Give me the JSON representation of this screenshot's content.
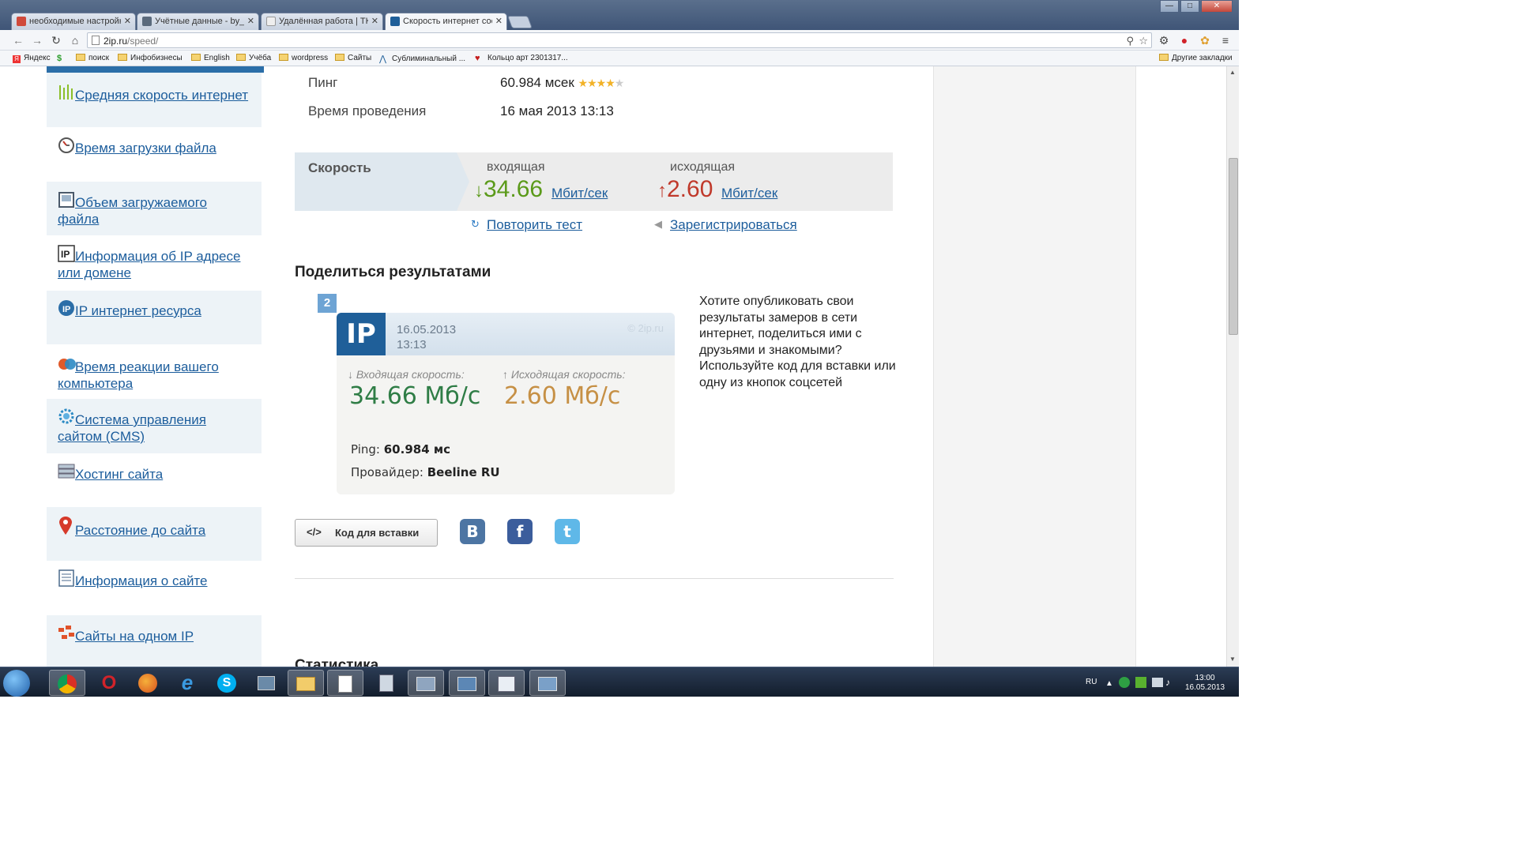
{
  "browser": {
    "tabs": [
      {
        "title": "необходимые настройки",
        "icon_color": "#d04a3b"
      },
      {
        "title": "Учётные данные - by_ma",
        "icon_color": "#5a6a7c"
      },
      {
        "title": "Удалённая работа | ТКС",
        "icon_color": "#dddddd"
      },
      {
        "title": "Скорость интернет соед",
        "icon_color": "#1f5f99"
      }
    ],
    "window_buttons": {
      "minimize": "—",
      "maximize": "□",
      "close": "✕"
    },
    "url_host": "2ip.ru",
    "url_path": "/speed/",
    "bookmarks": [
      {
        "label": "Яндекс",
        "type": "yandex"
      },
      {
        "label": "",
        "type": "money"
      },
      {
        "label": "поиск",
        "type": "folder"
      },
      {
        "label": "Инфобизнесы",
        "type": "folder"
      },
      {
        "label": "English",
        "type": "folder"
      },
      {
        "label": "Учёба",
        "type": "folder"
      },
      {
        "label": "wordpress",
        "type": "folder"
      },
      {
        "label": "Сайты",
        "type": "folder"
      },
      {
        "label": "Сублиминальный ...",
        "type": "triangle"
      },
      {
        "label": "Кольцо арт 2301317...",
        "type": "heart"
      }
    ],
    "other_bookmarks": "Другие закладки"
  },
  "sidebar": {
    "items": [
      {
        "label": "Средняя скорость интернет",
        "icon": "speed-bars-icon"
      },
      {
        "label": "Время загрузки файла",
        "icon": "clock-icon"
      },
      {
        "label": "Объем загружаемого файла",
        "icon": "disk-icon"
      },
      {
        "label": "Информация об IP адресе или домене",
        "icon": "ip-info-icon"
      },
      {
        "label": "IP интернет ресурса",
        "icon": "ip-globe-icon"
      },
      {
        "label": "Время реакции вашего компьютера",
        "icon": "refresh-icon"
      },
      {
        "label": "Система управления сайтом (CMS)",
        "icon": "gear-globe-icon"
      },
      {
        "label": "Хостинг сайта",
        "icon": "server-icon"
      },
      {
        "label": "Расстояние до сайта",
        "icon": "map-pin-icon"
      },
      {
        "label": "Информация о сайте",
        "icon": "document-icon"
      },
      {
        "label": "Сайты на одном IP",
        "icon": "network-icon"
      }
    ]
  },
  "result": {
    "ping_label": "Пинг",
    "ping_value": "60.984 мсек",
    "ping_rating": 4,
    "ping_rating_max": 5,
    "time_label": "Время проведения",
    "time_value": "16 мая 2013 13:13",
    "speed_label": "Скорость",
    "incoming_label": "входящая",
    "incoming_value": "34.66",
    "outgoing_label": "исходящая",
    "outgoing_value": "2.60",
    "unit": "Мбит/сек",
    "arrow_down": "↓",
    "arrow_up": "↑",
    "retest_label": "Повторить тест",
    "register_label": "Зарегистрироваться"
  },
  "share": {
    "title": "Поделиться результатами",
    "card": {
      "number": "2",
      "logo": "IP",
      "date": "16.05.2013",
      "time": "13:13",
      "brand": "© 2ip.ru",
      "in_label": "↓ Входящая скорость:",
      "in_value": "34.66 Мб/с",
      "out_label": "↑ Исходящая скорость:",
      "out_value": "2.60 Мб/с",
      "ping_label": "Ping:",
      "ping_value": "60.984 мс",
      "provider_label": "Провайдер:",
      "provider_value": "Beeline RU"
    },
    "description": "Хотите опубликовать свои результаты замеров в сети интернет, поделиться ими с друзьями и знакомыми? Используйте код для вставки или одну из кнопок соцсетей",
    "embed_label": "Код для вставки",
    "embed_icon": "</>",
    "vk_label": "B",
    "fb_label": "f",
    "tw_label": "t"
  },
  "stats_title_partial": "Статистика",
  "taskbar": {
    "language": "RU",
    "time": "13:00",
    "date": "16.05.2013"
  }
}
